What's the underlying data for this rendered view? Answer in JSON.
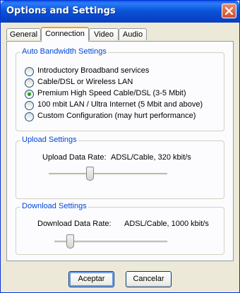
{
  "window": {
    "title": "Options and Settings"
  },
  "tabs": [
    {
      "label": "General"
    },
    {
      "label": "Connection",
      "selected": true
    },
    {
      "label": "Video"
    },
    {
      "label": "Audio"
    }
  ],
  "auto_bandwidth": {
    "legend": "Auto Bandwidth Settings",
    "options": [
      {
        "label": "Introductory Broadband services",
        "checked": false
      },
      {
        "label": "Cable/DSL or Wireless LAN",
        "checked": false
      },
      {
        "label": "Premium High Speed Cable/DSL (3-5 Mbit)",
        "checked": true
      },
      {
        "label": "100 mbit LAN / Ultra Internet (5 Mbit and above)",
        "checked": false
      },
      {
        "label": "Custom Configuration (may hurt performance)",
        "checked": false
      }
    ]
  },
  "upload": {
    "legend": "Upload Settings",
    "rate_label": "Upload Data Rate:",
    "rate_value": "ADSL/Cable, 320 kbit/s"
  },
  "download": {
    "legend": "Download Settings",
    "rate_label": "Download Data Rate:",
    "rate_value": "ADSL/Cable, 1000 kbit/s"
  },
  "buttons": {
    "ok": "Aceptar",
    "cancel": "Cancelar"
  },
  "colors": {
    "titlebar": "#0a55d8",
    "group_legend": "#0046d5",
    "radio_selected": "#21a121",
    "close_button": "#d0502b"
  }
}
